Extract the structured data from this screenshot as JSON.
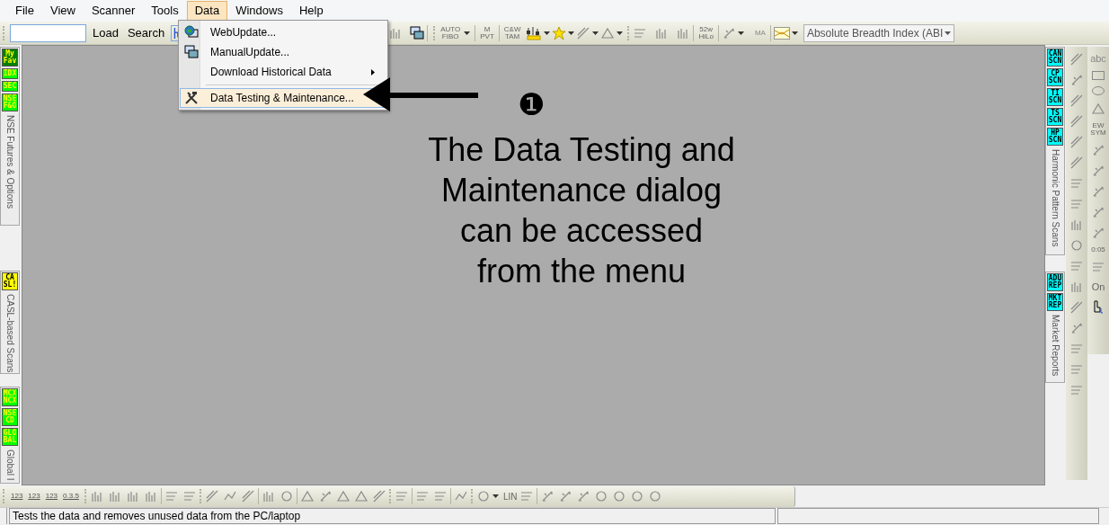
{
  "menu_bar": [
    {
      "label": "File",
      "selected": false
    },
    {
      "label": "View",
      "selected": false
    },
    {
      "label": "Scanner",
      "selected": false
    },
    {
      "label": "Tools",
      "selected": false
    },
    {
      "label": "Data",
      "selected": true
    },
    {
      "label": "Windows",
      "selected": false
    },
    {
      "label": "Help",
      "selected": false
    }
  ],
  "data_menu": [
    {
      "label": "WebUpdate...",
      "kind": "item",
      "highlighted": false,
      "separator_before": false
    },
    {
      "label": "ManualUpdate...",
      "kind": "item",
      "highlighted": false,
      "separator_before": false
    },
    {
      "label": "Download Historical Data",
      "kind": "submenu",
      "highlighted": false,
      "separator_before": false
    },
    {
      "label": "Data Testing & Maintenance...",
      "kind": "item",
      "highlighted": true,
      "separator_before": true
    }
  ],
  "toolbar": {
    "buttons": [
      "Load",
      "Search"
    ],
    "tool_labels": [
      {
        "lines": [
          "AUTO",
          "FIBO"
        ]
      },
      {
        "lines": [
          "M",
          "PVT"
        ]
      },
      {
        "lines": [
          "C&W",
          "TAM"
        ]
      },
      {
        "lines": [
          "52w",
          "HiLo"
        ]
      },
      {
        "lines": [
          "MA"
        ]
      }
    ],
    "indicator_select": {
      "value": "Absolute Breadth Index (ABI"
    }
  },
  "left_sidebar": [
    {
      "badges": [
        {
          "lines": [
            "My",
            "Fav"
          ],
          "color": "#008000"
        },
        {
          "lines": [
            "IDX"
          ],
          "color": "#00ff00"
        },
        {
          "lines": [
            "SEC"
          ],
          "color": "#00ff00"
        },
        {
          "lines": [
            "NSE",
            "F&O"
          ],
          "color": "#00ff00"
        }
      ],
      "title": "NSE Futures & Options"
    },
    {
      "badges": [
        {
          "lines": [
            "CA",
            "SL!"
          ],
          "color": "#ffff00"
        }
      ],
      "title": "CASL-based Scans"
    },
    {
      "badges": [
        {
          "lines": [
            "MCX",
            "NCX"
          ],
          "color": "#00ff00"
        },
        {
          "lines": [
            "NSE",
            "CD"
          ],
          "color": "#00ff00"
        },
        {
          "lines": [
            "GLO",
            "BAL"
          ],
          "color": "#00ff00"
        }
      ],
      "title": "Global I"
    }
  ],
  "right_sidebar": [
    {
      "badges": [
        {
          "lines": [
            "CAN",
            "SCN"
          ],
          "color": "#00ffff"
        },
        {
          "lines": [
            "CP",
            "SCN"
          ],
          "color": "#00ffff"
        },
        {
          "lines": [
            "TI",
            "SCN"
          ],
          "color": "#00ffff"
        },
        {
          "lines": [
            "TS",
            "SCN"
          ],
          "color": "#00ffff"
        },
        {
          "lines": [
            "HP",
            "SCN"
          ],
          "color": "#00ffff"
        }
      ],
      "title": "Harmonic Pattern Scans"
    },
    {
      "badges": [
        {
          "lines": [
            "ADU",
            "REP"
          ],
          "color": "#00ffff"
        },
        {
          "lines": [
            "MKT",
            "REP"
          ],
          "color": "#00ffff"
        }
      ],
      "title": "Market Reports"
    }
  ],
  "drawing_tools": {
    "labels": [
      "abc",
      "0:05",
      "On"
    ],
    "sym_lines": [
      "EW",
      "SYM"
    ]
  },
  "bottom_toolbar": {
    "labels": [
      "123",
      "123",
      "123",
      "0.3.5",
      "LIN"
    ]
  },
  "annotation": {
    "marker": "❶",
    "lines": [
      "The Data Testing and",
      "Maintenance dialog",
      "can be accessed",
      "from the menu"
    ]
  },
  "status_bar": {
    "message": "Tests the data and removes unused data from the PC/laptop"
  }
}
